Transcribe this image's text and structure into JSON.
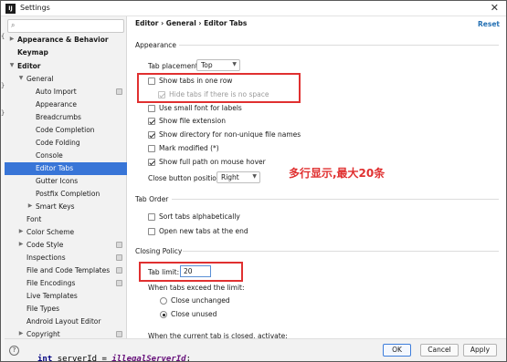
{
  "window": {
    "title": "Settings"
  },
  "sidebar": {
    "items": [
      {
        "label": "Appearance & Behavior",
        "arrow": "▶",
        "bold": true
      },
      {
        "label": "Keymap",
        "arrow": "",
        "bold": true
      },
      {
        "label": "Editor",
        "arrow": "▼",
        "bold": true
      },
      {
        "label": "General",
        "arrow": "▼",
        "bold": false
      },
      {
        "label": "Auto Import",
        "arrow": "",
        "bold": false,
        "proj": true
      },
      {
        "label": "Appearance",
        "arrow": "",
        "bold": false
      },
      {
        "label": "Breadcrumbs",
        "arrow": "",
        "bold": false
      },
      {
        "label": "Code Completion",
        "arrow": "",
        "bold": false
      },
      {
        "label": "Code Folding",
        "arrow": "",
        "bold": false
      },
      {
        "label": "Console",
        "arrow": "",
        "bold": false
      },
      {
        "label": "Editor Tabs",
        "arrow": "",
        "bold": false,
        "selected": true
      },
      {
        "label": "Gutter Icons",
        "arrow": "",
        "bold": false
      },
      {
        "label": "Postfix Completion",
        "arrow": "",
        "bold": false
      },
      {
        "label": "Smart Keys",
        "arrow": "▶",
        "bold": false
      },
      {
        "label": "Font",
        "arrow": "",
        "bold": false
      },
      {
        "label": "Color Scheme",
        "arrow": "▶",
        "bold": false
      },
      {
        "label": "Code Style",
        "arrow": "▶",
        "bold": false,
        "proj": true
      },
      {
        "label": "Inspections",
        "arrow": "",
        "bold": false,
        "proj": true
      },
      {
        "label": "File and Code Templates",
        "arrow": "",
        "bold": false,
        "proj": true
      },
      {
        "label": "File Encodings",
        "arrow": "",
        "bold": false,
        "proj": true
      },
      {
        "label": "Live Templates",
        "arrow": "",
        "bold": false
      },
      {
        "label": "File Types",
        "arrow": "",
        "bold": false
      },
      {
        "label": "Android Layout Editor",
        "arrow": "",
        "bold": false
      },
      {
        "label": "Copyright",
        "arrow": "▶",
        "bold": false,
        "proj": true
      }
    ]
  },
  "main": {
    "breadcrumb": "Editor  ›  General  ›  Editor Tabs",
    "reset": "Reset",
    "appearance": {
      "title": "Appearance",
      "tab_placement_label": "Tab placement:",
      "tab_placement_value": "Top",
      "show_tabs_one_row": "Show tabs in one row",
      "hide_tabs_no_space": "Hide tabs if there is no space",
      "small_font": "Use small font for labels",
      "show_file_ext": "Show file extension",
      "show_dir": "Show directory for non-unique file names",
      "mark_modified": "Mark modified (*)",
      "full_path": "Show full path on mouse hover",
      "close_btn_label": "Close button position:",
      "close_btn_value": "Right"
    },
    "tab_order": {
      "title": "Tab Order",
      "sort_alpha": "Sort tabs alphabetically",
      "open_at_end": "Open new tabs at the end"
    },
    "closing_policy": {
      "title": "Closing Policy",
      "tab_limit_label": "Tab limit:",
      "tab_limit_value": "20",
      "exceed_label": "When tabs exceed the limit:",
      "close_unchanged": "Close unchanged",
      "close_unused": "Close unused",
      "current_closed_label": "When the current tab is closed, activate:"
    }
  },
  "annotation": "多行显示,最大20条",
  "buttons": {
    "help": "?",
    "ok": "OK",
    "cancel": "Cancel",
    "apply": "Apply"
  },
  "code_peek": {
    "kw": "int",
    "var": "serverId",
    "eq": " = ",
    "val": "illegalServerId",
    "end": ";"
  },
  "colors": {
    "selection": "#3875d7",
    "annotation": "#e03030",
    "link": "#2470b3"
  }
}
